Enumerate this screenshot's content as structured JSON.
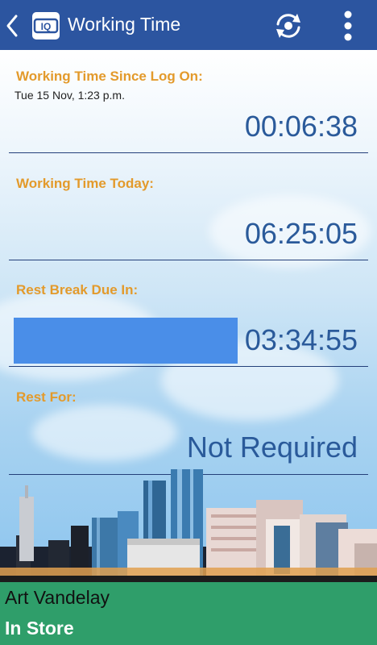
{
  "header": {
    "title": "Working Time",
    "back_icon": "chevron-left-icon",
    "logo_text": "IQ",
    "refresh_icon": "refresh-icon",
    "menu_icon": "more-vertical-icon"
  },
  "sections": [
    {
      "label": "Working Time Since Log On:",
      "sublabel": "Tue 15 Nov, 1:23 p.m.",
      "value": "00:06:38"
    },
    {
      "label": "Working Time Today:",
      "value": "06:25:05"
    },
    {
      "label": "Rest Break Due In:",
      "value": "03:34:55"
    },
    {
      "label": "Rest For:",
      "value": "Not Required"
    }
  ],
  "footer": {
    "user_name": "Art Vandelay",
    "location": "In Store"
  },
  "colors": {
    "appbar": "#2c55a0",
    "label": "#e39a2b",
    "value": "#2a5a9a",
    "footer": "#2f9e6a",
    "redaction": "#4a8ee8"
  }
}
